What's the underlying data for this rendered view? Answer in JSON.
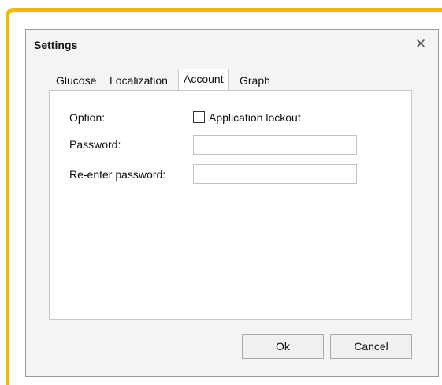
{
  "dialog": {
    "title": "Settings",
    "close_glyph": "✕"
  },
  "tabs": [
    {
      "label": "Glucose",
      "active": false
    },
    {
      "label": "Localization",
      "active": false
    },
    {
      "label": "Account",
      "active": true
    },
    {
      "label": "Graph",
      "active": false
    }
  ],
  "form": {
    "option_label": "Option:",
    "lockout_label": "Application lockout",
    "lockout_checked": false,
    "password_label": "Password:",
    "password_value": "",
    "reenter_label": "Re-enter password:",
    "reenter_value": ""
  },
  "buttons": {
    "ok": "Ok",
    "cancel": "Cancel"
  },
  "colors": {
    "frame_accent": "#f5b800"
  },
  "icons": {
    "close": "close-icon"
  }
}
